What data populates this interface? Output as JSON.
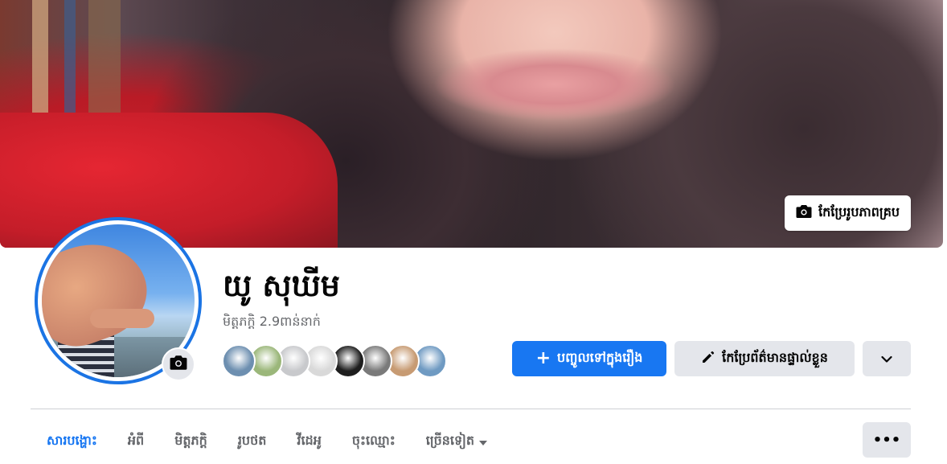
{
  "cover": {
    "edit_label": "កែប្រែរូបភាពគ្រប"
  },
  "profile": {
    "name": "យូ សុឃីម",
    "friends_count": "មិត្តភក្តិ 2.9ពាន់នាក់"
  },
  "friend_avatars": [
    "#6d8fb0",
    "#9bb77a",
    "#c8c9cc",
    "#d9d9d9",
    "#1e1e1e",
    "#7a7a7a",
    "#c79b73",
    "#6f9ac2"
  ],
  "actions": {
    "add_story_label": "បញ្ចូលទៅក្នុងរឿង",
    "edit_profile_label": "កែប្រែព័ត៌មានផ្ទាល់ខ្លួន"
  },
  "tabs": [
    {
      "label": "សារបង្ហោះ",
      "active": true
    },
    {
      "label": "អំពី"
    },
    {
      "label": "មិត្តភក្តិ"
    },
    {
      "label": "រូបថត"
    },
    {
      "label": "វីដេអូ"
    },
    {
      "label": "ចុះឈ្មោះ"
    },
    {
      "label": "ច្រើនទៀត"
    }
  ],
  "colors": {
    "accent": "#1877f2",
    "secondary_bg": "#e4e6eb",
    "muted_text": "#65676b"
  }
}
